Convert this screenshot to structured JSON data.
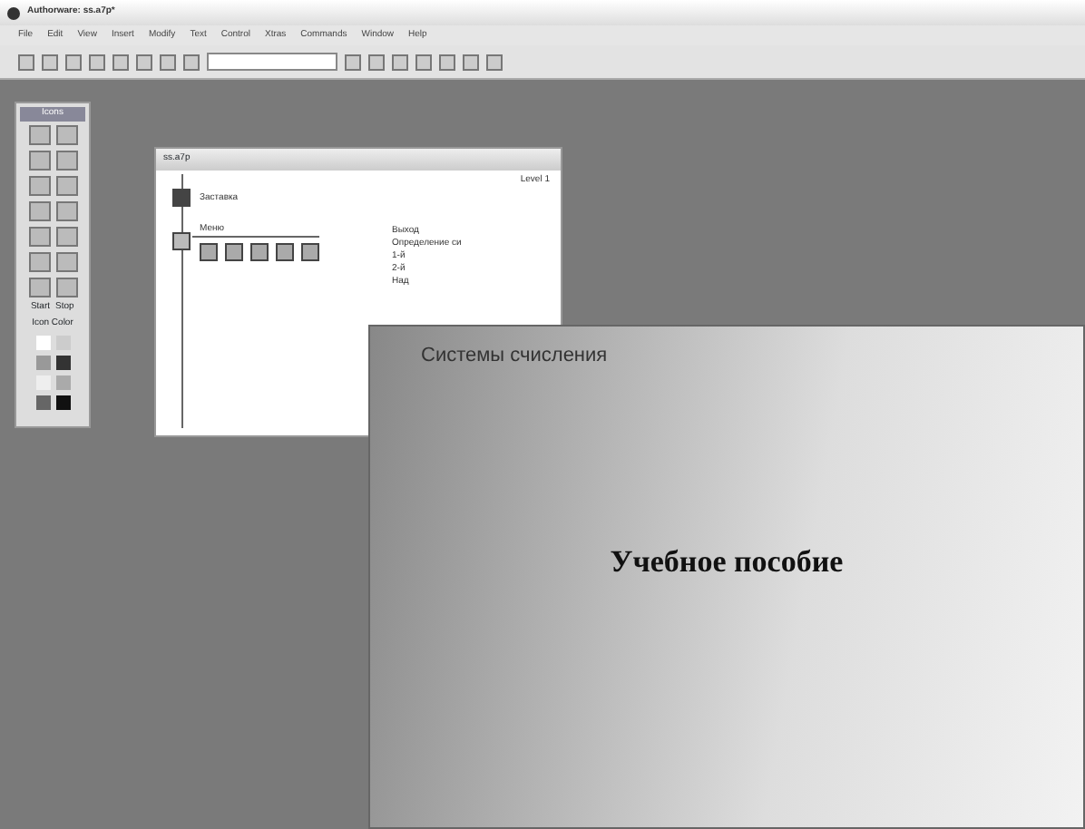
{
  "window": {
    "title": "Authorware: ss.a7p*"
  },
  "menu": [
    "File",
    "Edit",
    "View",
    "Insert",
    "Modify",
    "Text",
    "Control",
    "Xtras",
    "Commands",
    "Window",
    "Help"
  ],
  "icon_palette": {
    "title": "Icons",
    "flags": [
      "Start",
      "Stop"
    ],
    "color_label": "Icon Color"
  },
  "flowline_window": {
    "title": "ss.a7p",
    "level": "Level 1",
    "icons": [
      {
        "kind": "display",
        "label": "Заставка"
      },
      {
        "kind": "framework",
        "label": "Меню"
      }
    ],
    "branches": [
      {
        "kind": "map"
      },
      {
        "kind": "map"
      },
      {
        "kind": "map"
      },
      {
        "kind": "map"
      },
      {
        "kind": "map"
      }
    ],
    "branch_labels": [
      "Выход",
      "Определение си",
      "1-й",
      "2-й",
      "Над"
    ]
  },
  "presentation": {
    "header": "Системы счисления",
    "title": "Учебное пособие"
  }
}
